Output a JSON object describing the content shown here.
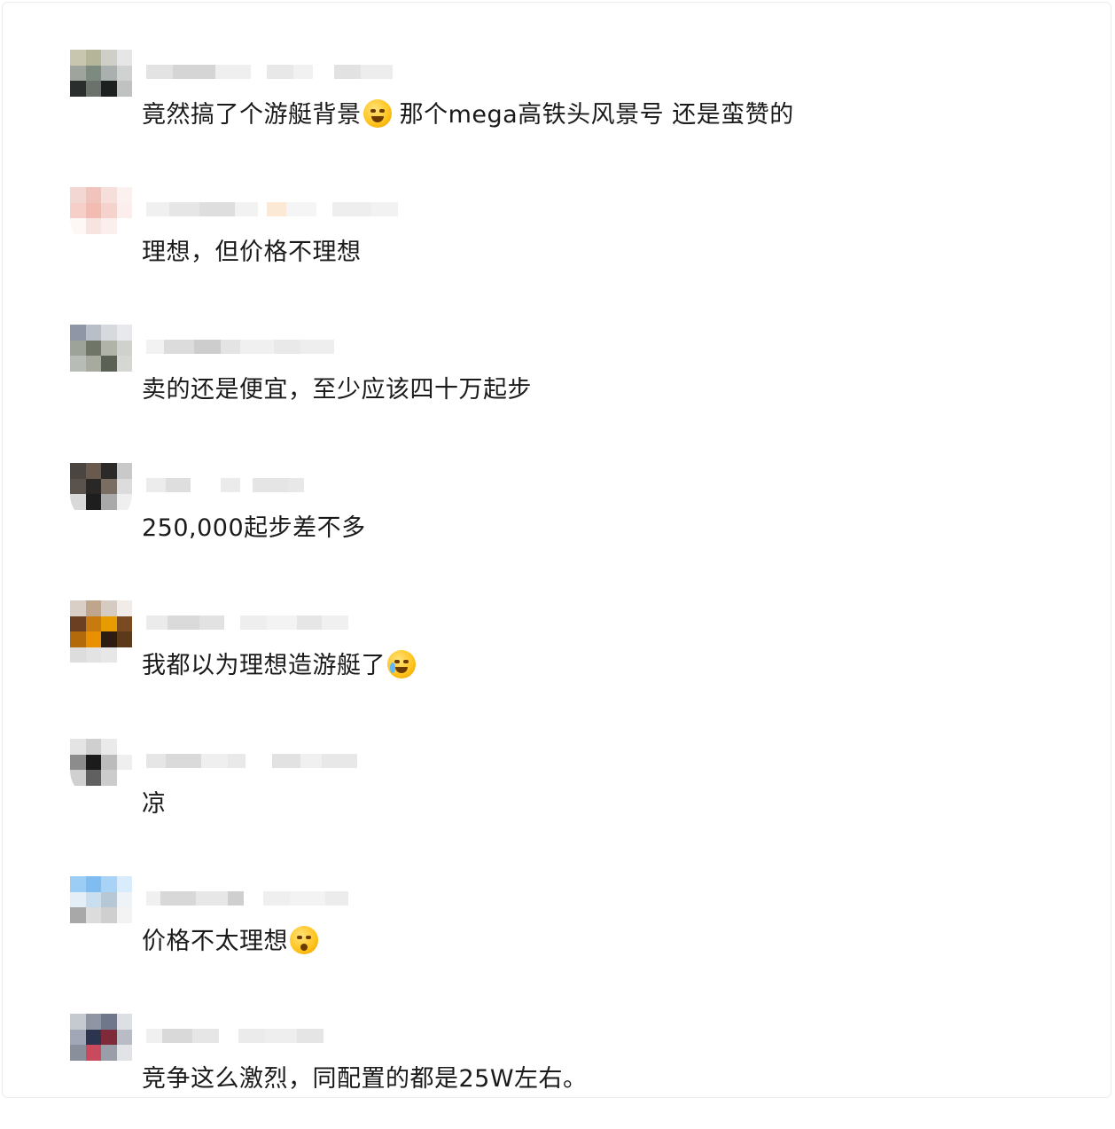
{
  "comments": [
    {
      "text": "竟然搞了个游艇背景",
      "emoji": "laughing-tears-emoji",
      "text_after": " 那个mega高铁头风景号 还是蛮赞的",
      "avatar_colors": [
        "#c9c6b0",
        "#b5b59a",
        "#cfcfc7",
        "#e6e6e6",
        "#9fa59c",
        "#7d8a80",
        "#aab0ad",
        "#d0d2d2",
        "#2a2f2e",
        "#6b726b",
        "#1c201f",
        "#bfc2c0",
        "#ffffff",
        "#ffffff",
        "#ffffff",
        "#ffffff"
      ],
      "name_colors": [
        "#e3e3e3",
        "#d5d5d5",
        "#efefef",
        "#ffffff",
        "#e8e8e8",
        "#f1f1f1",
        "#ffffff",
        "#e2e2e2",
        "#ededed"
      ]
    },
    {
      "text": "理想，但价格不理想",
      "emoji": "",
      "text_after": "",
      "avatar_colors": [
        "#f3d7d3",
        "#f0c4bd",
        "#f6dfdb",
        "#fbf2f0",
        "#f6cfc8",
        "#f2bcb3",
        "#f5d2cc",
        "#fbeeec",
        "#fdf7f6",
        "#f7e4e1",
        "#fbefed",
        "#ffffff",
        "#ffffff",
        "#ffffff",
        "#ffffff",
        "#ffffff"
      ],
      "name_colors": [
        "#f0f0f0",
        "#e6e6e6",
        "#dedede",
        "#f2f2f2",
        "#ffffff",
        "#fbe8d5",
        "#f5f5f5",
        "#ffffff",
        "#eeeeee",
        "#f2f2f2"
      ]
    },
    {
      "text": "卖的还是便宜，至少应该四十万起步",
      "emoji": "",
      "text_after": "",
      "avatar_colors": [
        "#8f97a6",
        "#b9bfc9",
        "#d6d9de",
        "#e8e9ec",
        "#9ea39a",
        "#6f7668",
        "#b0b4a8",
        "#cfd1cc",
        "#b8bcb6",
        "#a7ab9f",
        "#5b6255",
        "#d5d7d2",
        "#ffffff",
        "#ffffff",
        "#ffffff",
        "#ffffff"
      ],
      "name_colors": [
        "#f2f2f2",
        "#dcdcdc",
        "#cdcdcd",
        "#e4e4e4",
        "#f0f0f0",
        "#e9e9e9",
        "#eeeeee"
      ]
    },
    {
      "text": "250,000起步差不多",
      "emoji": "",
      "text_after": "",
      "avatar_colors": [
        "#4a4540",
        "#6a5a4e",
        "#2c2a28",
        "#c9c9c9",
        "#5a534d",
        "#2a2826",
        "#7a6e63",
        "#dcdcdc",
        "#d9d9d9",
        "#1e1e1e",
        "#a9a9a9",
        "#efefef",
        "#ffffff",
        "#ffffff",
        "#ffffff",
        "#ffffff"
      ],
      "name_colors": [
        "#ececec",
        "#dedede",
        "#ffffff",
        "#ebebeb",
        "#ffffff",
        "#e5e5e5",
        "#e8e8e8"
      ]
    },
    {
      "text": "我都以为理想造游艇了",
      "emoji": "crying-emoji",
      "text_after": "",
      "avatar_colors": [
        "#d9cfc7",
        "#bfa58c",
        "#d6cbc0",
        "#f1ece7",
        "#6b3f22",
        "#c77a10",
        "#e69b00",
        "#7a4a20",
        "#b36a0a",
        "#ea8f00",
        "#2c1c12",
        "#5a3a1a",
        "#dddddd",
        "#e3e3e3",
        "#e7e7e7",
        "#ffffff"
      ],
      "name_colors": [
        "#ebebeb",
        "#dadada",
        "#e2e2e2",
        "#ffffff",
        "#eeeeee",
        "#f3f3f3",
        "#e6e6e6",
        "#f0f0f0"
      ]
    },
    {
      "text": "凉",
      "emoji": "",
      "text_after": "",
      "avatar_colors": [
        "#e4e4e4",
        "#cfcfcf",
        "#eaeaea",
        "#ffffff",
        "#8c8c8c",
        "#1b1b1b",
        "#bcbcbc",
        "#efefef",
        "#d0d0d0",
        "#606060",
        "#cccccc",
        "#ffffff",
        "#ffffff",
        "#ffffff",
        "#ffffff",
        "#ffffff"
      ],
      "name_colors": [
        "#e6e6e6",
        "#dadada",
        "#efefef",
        "#e9e9e9",
        "#ffffff",
        "#e2e2e2",
        "#f0f0f0",
        "#e8e8e8"
      ]
    },
    {
      "text": "价格不太理想",
      "emoji": "flushed-emoji",
      "text_after": "",
      "avatar_colors": [
        "#9ccdf5",
        "#7fbcef",
        "#a9d3f6",
        "#d9ecfb",
        "#e4eef7",
        "#c9dff0",
        "#b6c8d6",
        "#eef3f7",
        "#a8a8a8",
        "#dcdcdc",
        "#cfcfcf",
        "#f3f3f3",
        "#ffffff",
        "#ffffff",
        "#ffffff",
        "#ffffff"
      ],
      "name_colors": [
        "#f0f0f0",
        "#d8d8d8",
        "#e7e7e7",
        "#cfcfcf",
        "#ffffff",
        "#efefef",
        "#f3f3f3",
        "#ececec"
      ]
    },
    {
      "text": "竞争这么激烈，同配置的都是25W左右。",
      "emoji": "",
      "text_after": "",
      "avatar_colors": [
        "#c5c9d0",
        "#8f95a3",
        "#6f778a",
        "#dcdfe4",
        "#a1a7b6",
        "#2c3550",
        "#7e2a38",
        "#b9bcc5",
        "#8a8f9c",
        "#c94a5c",
        "#9a9ea9",
        "#e2e3e7",
        "#ffffff",
        "#ffffff",
        "#ffffff",
        "#ffffff"
      ],
      "name_colors": [
        "#f0f0f0",
        "#d9d9d9",
        "#e6e6e6",
        "#ffffff",
        "#ebebeb",
        "#eeeeee",
        "#e5e5e5"
      ]
    }
  ]
}
